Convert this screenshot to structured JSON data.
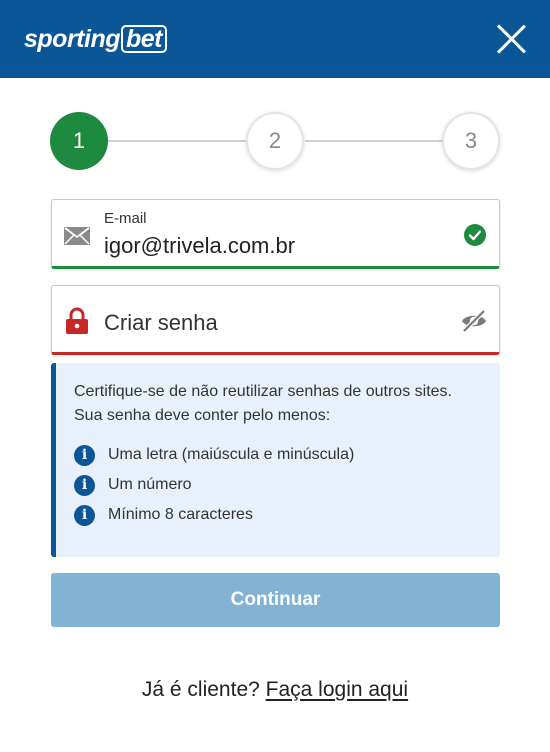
{
  "header": {
    "logo_main": "sporting",
    "logo_boxed": "bet",
    "close_icon": "close-icon",
    "background_color": "#0b5697"
  },
  "stepper": {
    "steps": [
      "1",
      "2",
      "3"
    ],
    "active_step": 1,
    "active_color": "#1e8a3f"
  },
  "email_field": {
    "label": "E-mail",
    "value": "igor@trivela.com.br",
    "icon": "mail-icon",
    "status_icon": "check-circle-icon",
    "status_color": "#1e8a3f"
  },
  "password_field": {
    "placeholder": "Criar senha",
    "icon": "lock-icon",
    "toggle_icon": "eye-off-icon",
    "status_color": "#c62828"
  },
  "info_box": {
    "text": "Certifique-se de não reutilizar senhas de outros sites. Sua senha deve conter pelo menos:",
    "requirements": [
      "Uma letra (maiúscula e minúscula)",
      "Um número",
      "Mínimo 8 caracteres"
    ],
    "icon": "info-icon"
  },
  "continue_button": {
    "label": "Continuar",
    "color": "#82b3d4"
  },
  "footer": {
    "prompt": "Já é cliente?",
    "login_link": "Faça login aqui"
  }
}
